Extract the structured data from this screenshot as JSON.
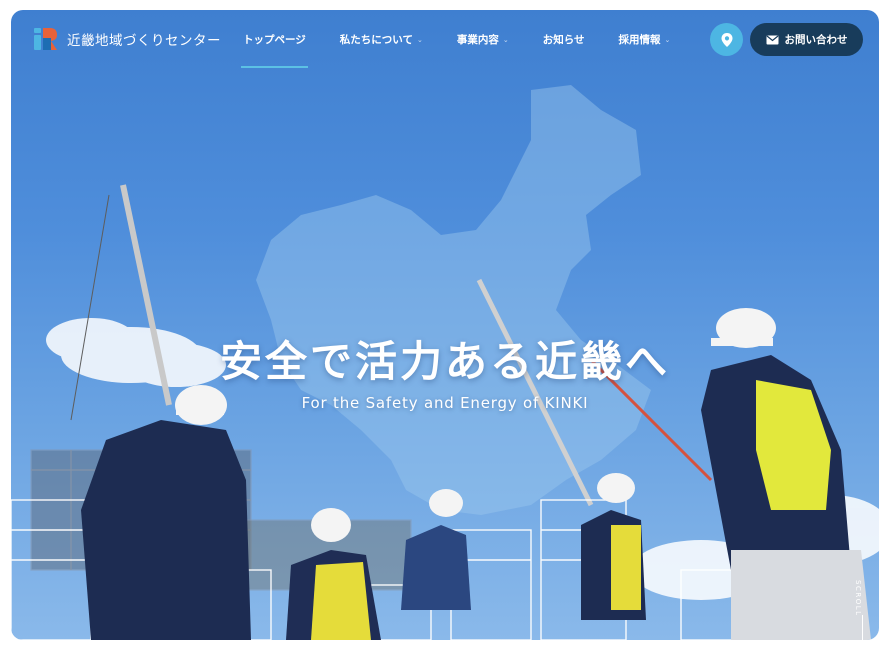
{
  "brand": {
    "name": "近畿地域づくりセンター",
    "logo_icon": "ic-logo-mark",
    "colors": {
      "primary_dark": "#183c5b",
      "accent": "#4db6e3",
      "sky": "#4f8edb"
    }
  },
  "nav": {
    "items": [
      {
        "label": "トップページ",
        "has_dropdown": false,
        "active": true
      },
      {
        "label": "私たちについて",
        "has_dropdown": true,
        "active": false
      },
      {
        "label": "事業内容",
        "has_dropdown": true,
        "active": false
      },
      {
        "label": "お知らせ",
        "has_dropdown": false,
        "active": false
      },
      {
        "label": "採用情報",
        "has_dropdown": true,
        "active": false
      }
    ]
  },
  "header_actions": {
    "access_icon": "map-pin-icon",
    "contact_icon": "mail-icon",
    "contact_label": "お問い合わせ"
  },
  "hero": {
    "title": "安全で活力ある近畿へ",
    "subtitle": "For the Safety and Energy of KINKI",
    "scroll_label": "SCROLL",
    "chevron_glyph": "⌄"
  }
}
